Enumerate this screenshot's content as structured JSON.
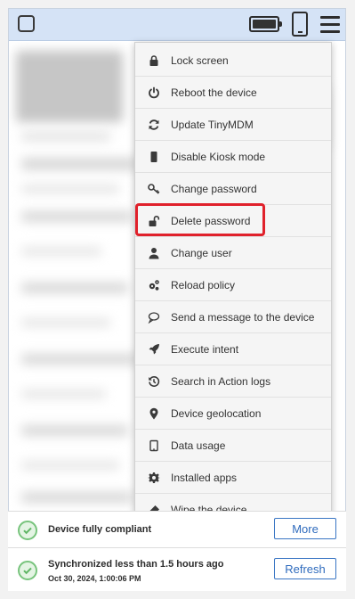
{
  "menu": {
    "items": [
      {
        "label": "Lock screen",
        "icon": "lock-icon"
      },
      {
        "label": "Reboot the device",
        "icon": "power-icon"
      },
      {
        "label": "Update TinyMDM",
        "icon": "refresh-icon"
      },
      {
        "label": "Disable Kiosk mode",
        "icon": "phone-icon"
      },
      {
        "label": "Change password",
        "icon": "key-icon"
      },
      {
        "label": "Delete password",
        "icon": "unlock-icon"
      },
      {
        "label": "Change user",
        "icon": "user-icon"
      },
      {
        "label": "Reload policy",
        "icon": "gears-icon"
      },
      {
        "label": "Send a message to the device",
        "icon": "speech-bubble-icon"
      },
      {
        "label": "Execute intent",
        "icon": "rocket-icon"
      },
      {
        "label": "Search in Action logs",
        "icon": "history-icon"
      },
      {
        "label": "Device geolocation",
        "icon": "map-marker-icon"
      },
      {
        "label": "Data usage",
        "icon": "tablet-icon"
      },
      {
        "label": "Installed apps",
        "icon": "gear-icon"
      },
      {
        "label": "Wipe the device",
        "icon": "eraser-icon"
      }
    ]
  },
  "footer": {
    "compliance_text": "Device fully compliant",
    "more_label": "More",
    "sync_text": "Synchronized less than 1.5 hours ago",
    "sync_date": "Oct 30, 2024, 1:00:06 PM",
    "refresh_label": "Refresh"
  },
  "colors": {
    "topbar": "#d5e3f6",
    "highlight": "#e0212b",
    "ok_green": "#78c47d",
    "button_blue": "#2f6bbd"
  }
}
